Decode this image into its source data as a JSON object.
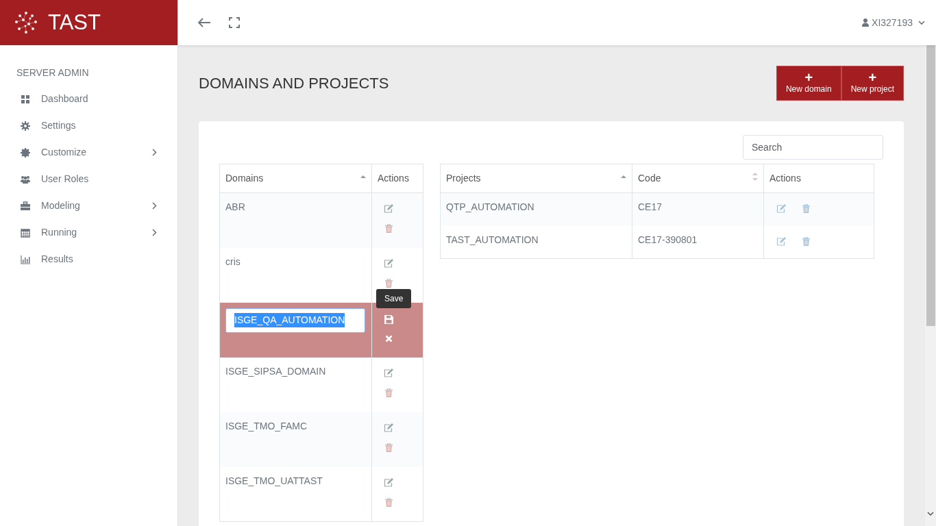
{
  "brand": {
    "name": "TAST"
  },
  "user": {
    "name": "XI327193"
  },
  "sidebar": {
    "heading": "SERVER ADMIN",
    "items": [
      {
        "label": "Dashboard",
        "has_submenu": false
      },
      {
        "label": "Settings",
        "has_submenu": false
      },
      {
        "label": "Customize",
        "has_submenu": true
      },
      {
        "label": "User Roles",
        "has_submenu": false
      },
      {
        "label": "Modeling",
        "has_submenu": true
      },
      {
        "label": "Running",
        "has_submenu": true
      },
      {
        "label": "Results",
        "has_submenu": false
      }
    ]
  },
  "page": {
    "title": "DOMAINS AND PROJECTS",
    "buttons": [
      {
        "label": "New domain",
        "icon": "+"
      },
      {
        "label": "New project",
        "icon": "+"
      }
    ]
  },
  "search": {
    "placeholder": "Search"
  },
  "domains": {
    "columns": [
      "Domains",
      "Actions"
    ],
    "rows": [
      {
        "name": "ABR",
        "editing": false
      },
      {
        "name": "cris",
        "editing": false
      },
      {
        "name": "ISGE_QA_AUTOMATION",
        "editing": true,
        "tooltip": "Save"
      },
      {
        "name": "ISGE_SIPSA_DOMAIN",
        "editing": false
      },
      {
        "name": "ISGE_TMO_FAMC",
        "editing": false
      },
      {
        "name": "ISGE_TMO_UATTAST",
        "editing": false
      }
    ]
  },
  "projects": {
    "columns": [
      "Projects",
      "Code",
      "Actions"
    ],
    "rows": [
      {
        "name": "QTP_AUTOMATION",
        "code": "CE17"
      },
      {
        "name": "TAST_AUTOMATION",
        "code": "CE17-390801"
      }
    ]
  }
}
